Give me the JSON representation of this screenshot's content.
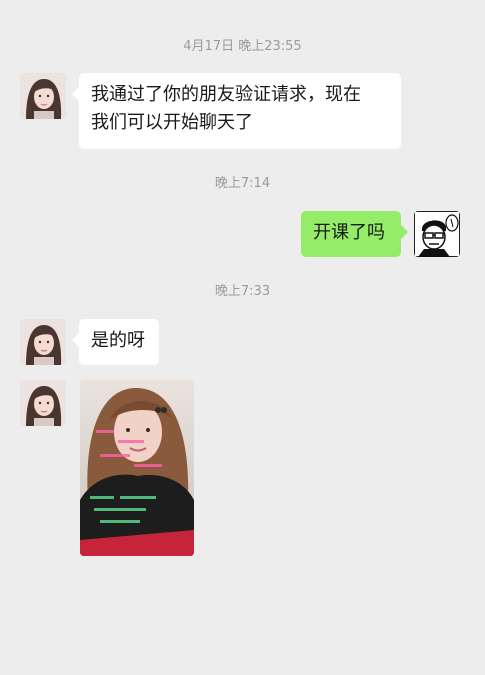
{
  "messages": [
    {
      "type": "timestamp",
      "text": "4月17日 晚上23:55"
    },
    {
      "type": "text",
      "side": "left",
      "text_line1": "我通过了你的朋友验证请求，现在",
      "text_line2": "我们可以开始聊天了"
    },
    {
      "type": "timestamp",
      "text": "晚上7:14"
    },
    {
      "type": "text",
      "side": "right",
      "text": "开课了吗"
    },
    {
      "type": "timestamp",
      "text": "晚上7:33"
    },
    {
      "type": "text",
      "side": "left",
      "text": "是的呀"
    },
    {
      "type": "image",
      "side": "left"
    }
  ],
  "colors": {
    "background": "#ededed",
    "incoming_bubble": "#ffffff",
    "outgoing_bubble": "#95ec69",
    "timestamp_text": "#9b9b9b"
  }
}
